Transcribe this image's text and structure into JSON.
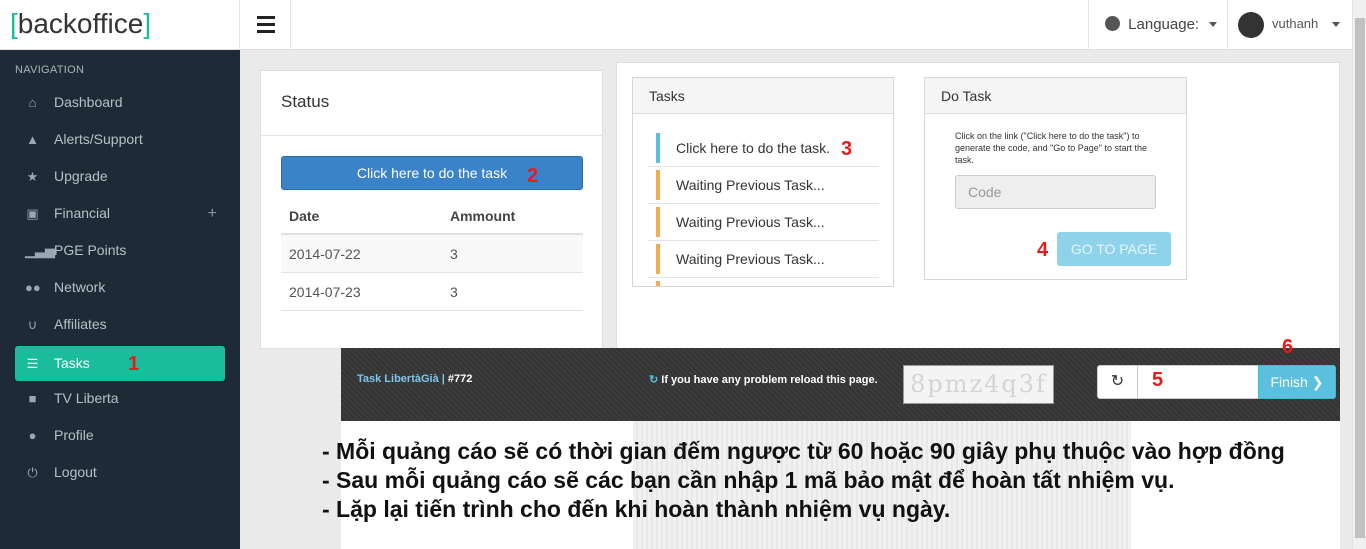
{
  "header": {
    "logo_left": "[",
    "logo_text": "backoffice",
    "logo_right": "]",
    "language_label": "Language:",
    "username": "vuthanh"
  },
  "sidebar": {
    "title": "NAVIGATION",
    "items": [
      {
        "label": "Dashboard",
        "icon": "home-icon"
      },
      {
        "label": "Alerts/Support",
        "icon": "warning-icon"
      },
      {
        "label": "Upgrade",
        "icon": "star-icon"
      },
      {
        "label": "Financial",
        "icon": "money-icon",
        "expand": "+"
      },
      {
        "label": "PGE Points",
        "icon": "signal-icon"
      },
      {
        "label": "Network",
        "icon": "users-icon"
      },
      {
        "label": "Affiliates",
        "icon": "magnet-icon"
      },
      {
        "label": "Tasks",
        "icon": "tasks-icon",
        "active": true
      },
      {
        "label": "TV Liberta",
        "icon": "video-icon"
      },
      {
        "label": "Profile",
        "icon": "user-icon"
      },
      {
        "label": "Logout",
        "icon": "power-icon"
      }
    ]
  },
  "annotations": {
    "a1": "1",
    "a2": "2",
    "a3": "3",
    "a4": "4",
    "a5": "5",
    "a6": "6"
  },
  "status": {
    "title": "Status",
    "button": "Click here to do the task",
    "columns": [
      "Date",
      "Ammount"
    ],
    "rows": [
      {
        "date": "2014-07-22",
        "amount": "3"
      },
      {
        "date": "2014-07-23",
        "amount": "3"
      }
    ]
  },
  "tasks": {
    "title": "Tasks",
    "items": [
      "Click here to do the task.",
      "Waiting Previous Task...",
      "Waiting Previous Task...",
      "Waiting Previous Task..."
    ]
  },
  "do_task": {
    "title": "Do Task",
    "instructions": "Click on the link (\"Click here to do the task\") to generate the code, and \"Go to Page\" to start the task.",
    "code_placeholder": "Code",
    "go_button": "GO TO PAGE"
  },
  "taskbar": {
    "title": "Task LibertàGià |",
    "number": "#772",
    "reload_text": "If you have any problem reload this page.",
    "captcha": "8pmz4q3f",
    "finish": "Finish"
  },
  "notes": [
    "- Mỗi quảng cáo sẽ có thời gian đếm ngược từ 60 hoặc 90 giây phụ thuộc vào hợp đồng",
    "- Sau mỗi quảng cáo sẽ các bạn cần nhập 1 mã bảo mật để hoàn tất nhiệm vụ.",
    "- Lặp lại tiến trình cho đến khi hoàn thành nhiệm vụ ngày."
  ],
  "colors": {
    "accent": "#1abc9c",
    "primary": "#3b83c8",
    "info": "#5bc0de",
    "warning": "#f0ad4e",
    "annotation": "#e51c1c"
  }
}
